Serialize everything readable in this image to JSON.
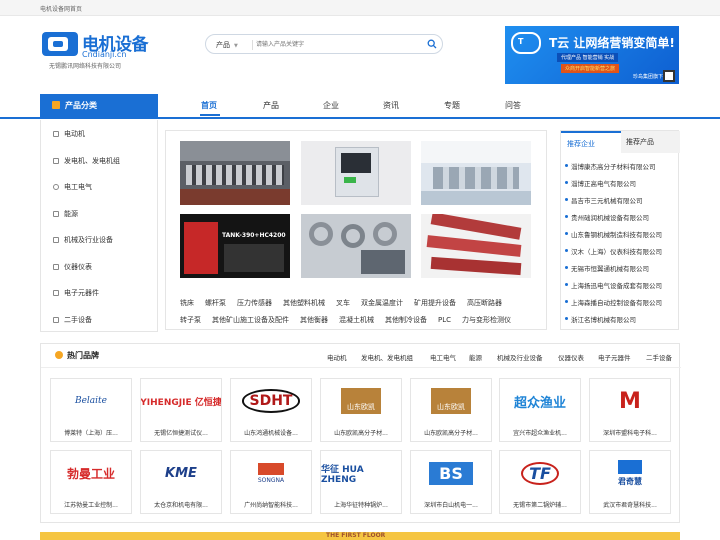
{
  "topbar": {
    "text": "电机设备网首页"
  },
  "logo": {
    "cn": "电机设备",
    "en": "Cndianji.cn",
    "company": "无锡鹏讯网络科技有限公司"
  },
  "search": {
    "category": "产品",
    "placeholder": "请输入产品关键字"
  },
  "ad": {
    "headline": "T云 让网络营销变简单!",
    "line1": "代理产品 智能营销 实战",
    "line2": "众商开启智能新营之旅",
    "brand": "珍岛集团旗下"
  },
  "nav": {
    "category_title": "产品分类",
    "items": [
      "首页",
      "产品",
      "企业",
      "资讯",
      "专题",
      "问答"
    ]
  },
  "sidebar": {
    "items": [
      "电动机",
      "发电机、发电机组",
      "电工电气",
      "能源",
      "机械及行业设备",
      "仪器仪表",
      "电子元器件",
      "二手设备"
    ]
  },
  "product_tags": {
    "row1": [
      "铣床",
      "螺杆泵",
      "压力传感器",
      "其他塑料机械",
      "叉车",
      "双金属温度计",
      "矿用提升设备",
      "高压断路器"
    ],
    "row2": [
      "转子泵",
      "其他矿山施工设备及配件",
      "其他衡器",
      "混凝土机械",
      "其他制冷设备",
      "PLC",
      "力与变形检测仪"
    ]
  },
  "photo_texts": {
    "tank": "TANK-390+HC4200"
  },
  "right_panel": {
    "tabs": [
      "推荐企业",
      "推荐产品"
    ],
    "companies": [
      "淄博康杰高分子材料有限公司",
      "淄博正高电气有限公司",
      "昌吉市三元机械有限公司",
      "贵州础润机械设备有限公司",
      "山东鲁钢机械制造科技有限公司",
      "汉木（上海）仪表科技有限公司",
      "无锡市恒翼通机械有限公司",
      "上海扬迅电气设备成套有限公司",
      "上海森播自动控制设备有限公司",
      "浙江名博机械有限公司"
    ]
  },
  "brands": {
    "title": "热门品牌",
    "links": [
      "电动机",
      "发电机、发电机组",
      "电工电气",
      "能源",
      "机械及行业设备",
      "仪器仪表",
      "电子元器件",
      "二手设备"
    ],
    "row1": [
      {
        "logo": "Belaite",
        "name": "博莱特（上海）压..."
      },
      {
        "logo": "YIHENGJIE 亿恒捷",
        "name": "无锡亿恒捷测试仪..."
      },
      {
        "logo": "SDHT",
        "name": "山东鸿通机械设备..."
      },
      {
        "logo": "山东欧凯",
        "name": "山东欧凯高分子材..."
      },
      {
        "logo": "山东欧凯",
        "name": "山东欧凯高分子材..."
      },
      {
        "logo": "超众渔业",
        "name": "宜兴市超众渔业机..."
      },
      {
        "logo": "M",
        "name": "深圳市盟科电子科..."
      }
    ],
    "row2": [
      {
        "logo": "勃曼工业",
        "name": "江苏勃曼工业控制..."
      },
      {
        "logo": "KME",
        "name": "太仓京和机电有限..."
      },
      {
        "logo": "SONGNA",
        "name": "广州尚纳智能科技..."
      },
      {
        "logo": "华征 HUA ZHENG",
        "name": "上海华征特种锅炉..."
      },
      {
        "logo": "BS",
        "name": "深圳市白山机电一..."
      },
      {
        "logo": "TF",
        "name": "无锡市第二锅炉辅..."
      },
      {
        "logo": "君奇慧",
        "name": "武汉市君奇慧科技..."
      }
    ]
  },
  "floor": {
    "label": "THE FIRST FLOOR"
  },
  "colors": {
    "primary": "#1a6fd4",
    "accent": "#f5a623"
  }
}
